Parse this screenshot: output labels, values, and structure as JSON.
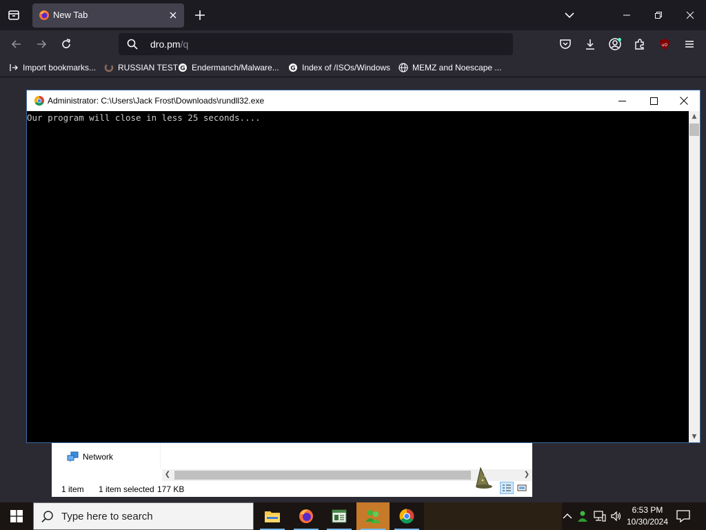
{
  "browser": {
    "tab": {
      "title": "New Tab"
    },
    "url": {
      "host": "dro.pm",
      "path": "/q"
    },
    "bookmarks": [
      {
        "label": "Import bookmarks...",
        "icon": "import-icon"
      },
      {
        "label": "RUSSIAN TEST",
        "icon": "spinner-icon"
      },
      {
        "label": "Endermanch/Malware...",
        "icon": "google-icon"
      },
      {
        "label": "Index of /ISOs/Windows",
        "icon": "google-icon"
      },
      {
        "label": "MEMZ and Noescape ...",
        "icon": "globe-icon"
      }
    ],
    "accent": "#fbfbfe",
    "background": "#2b2a33"
  },
  "console": {
    "title": "Administrator:  C:\\Users\\Jack Frost\\Downloads\\rundll32.exe",
    "output": "Our program will close in less 25 seconds....",
    "text_color": "#cccccc"
  },
  "explorer": {
    "nav_item": "Network",
    "status_items": "1 item",
    "status_selected": "1 item selected",
    "status_size": "177 KB"
  },
  "taskbar": {
    "search_placeholder": "Type here to search",
    "time": "6:53 PM",
    "date": "10/30/2024",
    "apps": [
      "file-explorer",
      "firefox",
      "task-manager",
      "network-app",
      "chrome"
    ]
  }
}
